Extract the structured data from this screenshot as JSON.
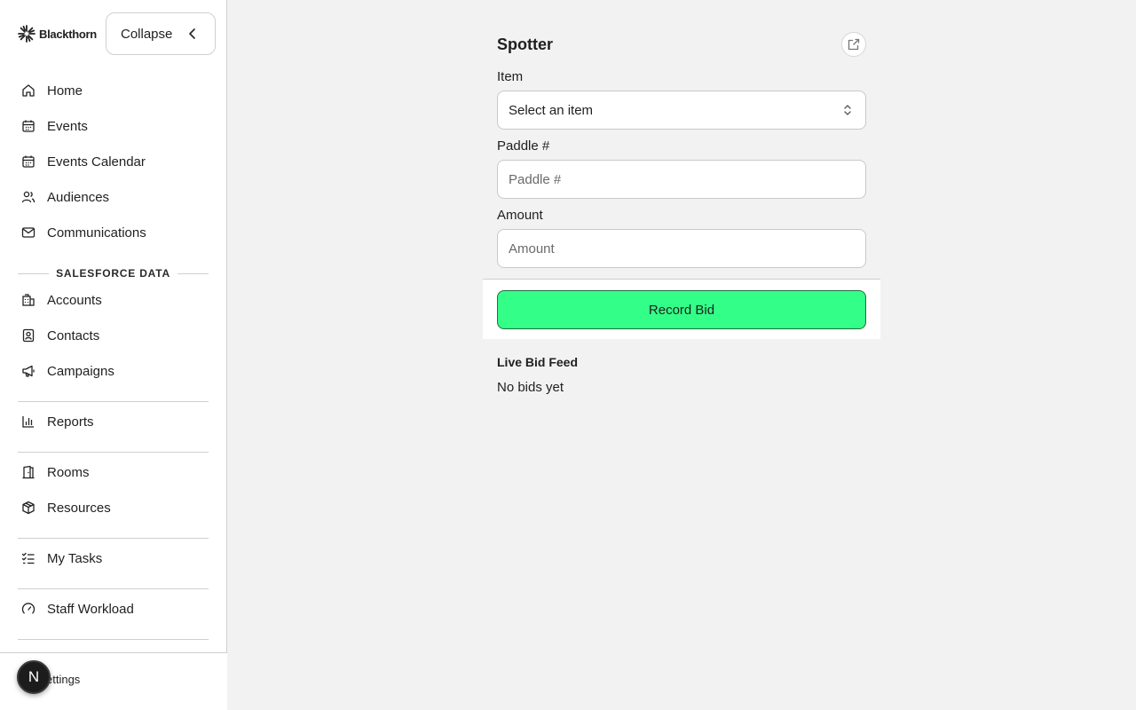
{
  "sidebar": {
    "brand": {
      "name": "Blackthorn",
      "icon": "blackthorn-logo-icon"
    },
    "collapse_label": "Collapse",
    "nav_main": [
      {
        "label": "Home",
        "icon": "home-icon"
      },
      {
        "label": "Events",
        "icon": "calendar-icon"
      },
      {
        "label": "Events Calendar",
        "icon": "calendar-icon"
      },
      {
        "label": "Audiences",
        "icon": "users-icon"
      },
      {
        "label": "Communications",
        "icon": "mail-icon"
      }
    ],
    "section_heading": "SALESFORCE DATA",
    "nav_salesforce": [
      {
        "label": "Accounts",
        "icon": "building-icon"
      },
      {
        "label": "Contacts",
        "icon": "contact-icon"
      },
      {
        "label": "Campaigns",
        "icon": "megaphone-icon"
      }
    ],
    "nav_reports": {
      "label": "Reports",
      "icon": "bar-chart-icon"
    },
    "nav_rooms": [
      {
        "label": "Rooms",
        "icon": "door-icon"
      },
      {
        "label": "Resources",
        "icon": "box-icon"
      }
    ],
    "nav_tasks": {
      "label": "My Tasks",
      "icon": "checklist-icon"
    },
    "nav_workload": {
      "label": "Staff Workload",
      "icon": "gauge-icon"
    },
    "settings_label": "ettings",
    "avatar_initial": "N"
  },
  "panel": {
    "title": "Spotter",
    "item_label": "Item",
    "item_value": "Select an item",
    "paddle_label": "Paddle #",
    "paddle_placeholder": "Paddle #",
    "amount_label": "Amount",
    "amount_placeholder": "Amount",
    "record_label": "Record Bid",
    "feed_title": "Live Bid Feed",
    "feed_empty": "No bids yet"
  },
  "colors": {
    "accent": "#33ff88",
    "sidebar_bg": "#ffffff",
    "main_bg": "#f2f2f2"
  }
}
